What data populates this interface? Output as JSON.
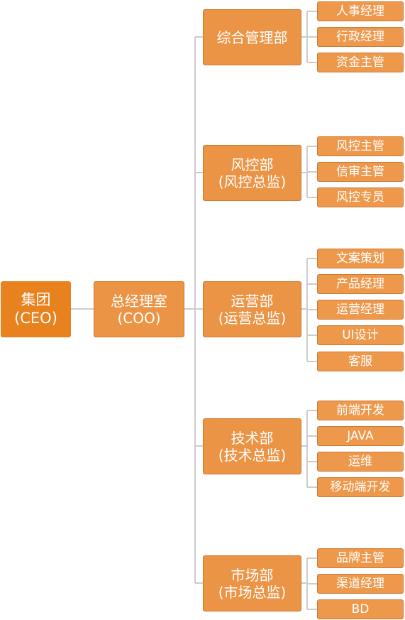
{
  "diagram": {
    "root": {
      "line1": "集团",
      "line2": "(CEO)"
    },
    "coo": {
      "line1": "总经理室",
      "line2": "(COO)"
    },
    "departments": [
      {
        "line1": "综合管理部",
        "line2": "",
        "roles": [
          "人事经理",
          "行政经理",
          "资金主管"
        ]
      },
      {
        "line1": "风控部",
        "line2": "(风控总监)",
        "roles": [
          "风控主管",
          "信审主管",
          "风控专员"
        ]
      },
      {
        "line1": "运营部",
        "line2": "(运营总监)",
        "roles": [
          "文案策划",
          "产品经理",
          "运营经理",
          "UI设计",
          "客服"
        ]
      },
      {
        "line1": "技术部",
        "line2": "(技术总监)",
        "roles": [
          "前端开发",
          "JAVA",
          "运维",
          "移动端开发"
        ]
      },
      {
        "line1": "市场部",
        "line2": "(市场总监)",
        "roles": [
          "品牌主管",
          "渠道经理",
          "BD"
        ]
      }
    ],
    "colors": {
      "node_fill": "#ee984c",
      "root_fill": "#e8821f",
      "connector": "#cccccc",
      "text": "#ffffff"
    }
  }
}
